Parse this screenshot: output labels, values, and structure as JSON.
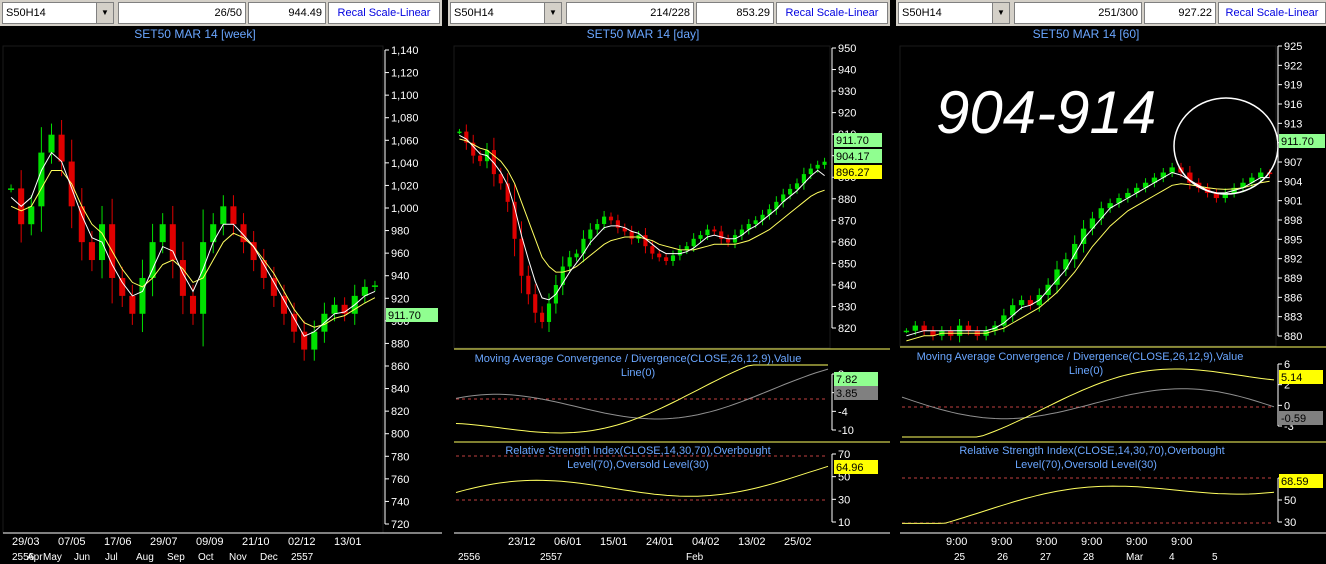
{
  "panels": [
    {
      "symbol": "S50H14",
      "counter": "26/50",
      "price": "944.49",
      "recal_label": "Recal Scale-Linear",
      "title": "SET50 MAR 14   [week]",
      "y_ticks": [
        "1,140",
        "1,120",
        "1,100",
        "1,080",
        "1,060",
        "1,040",
        "1,020",
        "1,000",
        "980",
        "960",
        "940",
        "920",
        "900",
        "880",
        "860",
        "840",
        "820",
        "800",
        "780",
        "760",
        "740",
        "720"
      ],
      "last_price": "911.70",
      "x_date_labels": [
        "29/03",
        "07/05",
        "17/06",
        "29/07",
        "09/09",
        "21/10",
        "02/12",
        "13/01"
      ],
      "x_month_labels": [
        "2556",
        "May",
        "Jun",
        "Jul",
        "Aug",
        "Sep",
        "Oct",
        "Nov",
        "Dec",
        "2557"
      ],
      "x_month_partial": "Apr"
    },
    {
      "symbol": "S50H14",
      "counter": "214/228",
      "price": "853.29",
      "recal_label": "Recal Scale-Linear",
      "title": "SET50 MAR 14   [day]",
      "y_ticks": [
        "950",
        "940",
        "930",
        "920",
        "910",
        "900",
        "890",
        "880",
        "870",
        "860",
        "850",
        "840",
        "830",
        "820"
      ],
      "labels": [
        "911.70",
        "904.17",
        "896.27"
      ],
      "macd_title": "Moving Average Convergence / Divergence(CLOSE,26,12,9),Value",
      "macd_line": "Line(0)",
      "macd_ticks": [
        "8",
        "2",
        "-4",
        "-10"
      ],
      "macd_labels": [
        "7.82",
        "3.85"
      ],
      "rsi_title": "Relative Strength Index(CLOSE,14,30,70),Overbought",
      "rsi_line": "Level(70),Oversold Level(30)",
      "rsi_ticks": [
        "70",
        "50",
        "30",
        "10"
      ],
      "rsi_label": "64.96",
      "x_date_labels": [
        "23/12",
        "06/01",
        "15/01",
        "24/01",
        "04/02",
        "13/02",
        "25/02"
      ],
      "x_month_labels": [
        "2556",
        "2557",
        "Feb"
      ]
    },
    {
      "symbol": "S50H14",
      "counter": "251/300",
      "price": "927.22",
      "recal_label": "Recal Scale-Linear",
      "title": "SET50 MAR 14   [60]",
      "note": "904-914",
      "y_ticks": [
        "925",
        "922",
        "919",
        "916",
        "913",
        "910",
        "907",
        "904",
        "901",
        "898",
        "895",
        "892",
        "889",
        "886",
        "883",
        "880"
      ],
      "last_price": "911.70",
      "macd_title": "Moving Average Convergence / Divergence(CLOSE,26,12,9),Value",
      "macd_line": "Line(0)",
      "macd_ticks": [
        "6",
        "2",
        "0",
        "-3"
      ],
      "macd_labels": [
        "5.14",
        "-0.59"
      ],
      "rsi_title": "Relative Strength Index(CLOSE,14,30,70),Overbought",
      "rsi_line": "Level(70),Oversold Level(30)",
      "rsi_ticks": [
        "70",
        "50",
        "30"
      ],
      "rsi_label": "68.59",
      "x_time_labels": [
        "9:00",
        "9:00",
        "9:00",
        "9:00",
        "9:00",
        "9:00"
      ],
      "x_day_labels": [
        "25",
        "26",
        "27",
        "28",
        "Mar",
        "4",
        "5"
      ]
    }
  ],
  "chart_data": [
    {
      "type": "candlestick",
      "title": "SET50 MAR 14   [week]",
      "ylim": [
        710,
        1150
      ],
      "close": [
        1020,
        980,
        1000,
        1060,
        1080,
        1050,
        1000,
        960,
        940,
        980,
        920,
        900,
        880,
        920,
        960,
        980,
        940,
        900,
        880,
        960,
        980,
        1000,
        980,
        960,
        940,
        920,
        900,
        880,
        860,
        840,
        860,
        880,
        890,
        880,
        900,
        910,
        911.7
      ],
      "ma_fast": [
        1010,
        1000,
        1010,
        1040,
        1060,
        1050,
        1020,
        990,
        965,
        960,
        935,
        915,
        900,
        905,
        930,
        955,
        950,
        925,
        905,
        930,
        960,
        980,
        980,
        968,
        955,
        935,
        915,
        895,
        875,
        855,
        860,
        870,
        880,
        882,
        890,
        900,
        905
      ],
      "ma_slow": [
        1000,
        995,
        1000,
        1020,
        1040,
        1040,
        1025,
        1000,
        980,
        970,
        950,
        930,
        915,
        910,
        920,
        935,
        940,
        930,
        915,
        920,
        940,
        960,
        970,
        965,
        955,
        940,
        925,
        905,
        885,
        870,
        865,
        868,
        875,
        878,
        885,
        892,
        898
      ]
    },
    {
      "type": "candlestick",
      "title": "SET50 MAR 14   [day]",
      "ylim": [
        812,
        957
      ],
      "close": [
        928,
        922,
        915,
        912,
        918,
        905,
        900,
        890,
        870,
        850,
        840,
        830,
        825,
        835,
        845,
        855,
        860,
        862,
        870,
        875,
        878,
        882,
        880,
        876,
        874,
        870,
        872,
        866,
        862,
        860,
        858,
        861,
        864,
        866,
        870,
        872,
        875,
        874,
        870,
        868,
        872,
        875,
        878,
        880,
        883,
        886,
        890,
        894,
        897,
        900,
        905,
        908,
        910,
        911.7
      ],
      "ma_fast": [
        926,
        924,
        920,
        916,
        915,
        911,
        906,
        899,
        887,
        872,
        859,
        847,
        838,
        837,
        840,
        846,
        852,
        857,
        862,
        868,
        872,
        876,
        877,
        877,
        876,
        874,
        873,
        870,
        867,
        864,
        862,
        862,
        862,
        863,
        865,
        868,
        871,
        872,
        871,
        870,
        870,
        872,
        875,
        877,
        880,
        883,
        886,
        890,
        893,
        896,
        900,
        904,
        907,
        904.17
      ],
      "ma_slow": [
        924,
        923,
        921,
        919,
        918,
        915,
        912,
        907,
        900,
        890,
        880,
        870,
        860,
        855,
        852,
        852,
        853,
        855,
        858,
        861,
        864,
        867,
        869,
        870,
        871,
        871,
        871,
        870,
        869,
        867,
        866,
        865,
        864,
        864,
        864,
        865,
        866,
        867,
        867,
        867,
        867,
        868,
        869,
        871,
        873,
        875,
        878,
        881,
        884,
        887,
        890,
        893,
        895,
        896.27
      ],
      "macd": {
        "ylim": [
          -14,
          11
        ],
        "levels": [
          8,
          2,
          -4,
          -10
        ],
        "value": 7.82,
        "signal": 3.85
      },
      "rsi": {
        "ylim": [
          0,
          80
        ],
        "overbought": 70,
        "oversold": 30,
        "value": 64.96
      }
    },
    {
      "type": "candlestick",
      "title": "SET50 MAR 14   [60]",
      "ylim": [
        878,
        927
      ],
      "close": [
        881,
        882,
        881,
        880,
        881,
        880,
        882,
        881,
        880,
        881,
        882,
        884,
        886,
        887,
        886,
        888,
        890,
        893,
        895,
        898,
        901,
        903,
        905,
        906,
        907,
        908,
        909,
        910,
        911,
        912,
        913,
        912,
        910,
        909,
        908,
        907,
        908,
        909,
        910,
        911,
        912,
        911.7
      ],
      "ma_fast": [
        880,
        880.5,
        881,
        881,
        881,
        881,
        881,
        881,
        881,
        881,
        881.5,
        882.5,
        884,
        885.5,
        886,
        887,
        889,
        891,
        893,
        896,
        899,
        901,
        903,
        905,
        906,
        907,
        908,
        909,
        910,
        911,
        912,
        911.5,
        910.5,
        909.5,
        908.5,
        908,
        908,
        908.5,
        909,
        910,
        911,
        911
      ],
      "ma_slow": [
        879,
        879.5,
        880,
        880,
        880.5,
        880.5,
        880.5,
        880.5,
        880.5,
        880.5,
        881,
        881.5,
        882.5,
        883.5,
        884.5,
        885.5,
        887,
        888.5,
        890.5,
        892.5,
        895,
        897.5,
        899.5,
        901.5,
        903,
        904.5,
        905.5,
        906.5,
        907.5,
        908.5,
        909.5,
        909.8,
        909.6,
        909.3,
        909,
        908.8,
        908.7,
        908.8,
        909,
        909.5,
        910,
        910.3
      ],
      "macd": {
        "ylim": [
          -4,
          7
        ],
        "levels": [
          6,
          2,
          0,
          -3
        ],
        "value": 5.14,
        "signal": -0.59
      },
      "rsi": {
        "ylim": [
          20,
          80
        ],
        "overbought": 70,
        "oversold": 30,
        "value": 68.59
      }
    }
  ],
  "colors": {
    "up": "#00e000",
    "down": "#e00000",
    "ma_fast": "#ffffff",
    "ma_slow": "#ffff60",
    "grid": "#1a1a1a",
    "text": "#ffffff",
    "title": "#6aa6ff",
    "accent_green": "#90ff90",
    "accent_yellow": "#ffff00",
    "label_gray": "#808080"
  }
}
